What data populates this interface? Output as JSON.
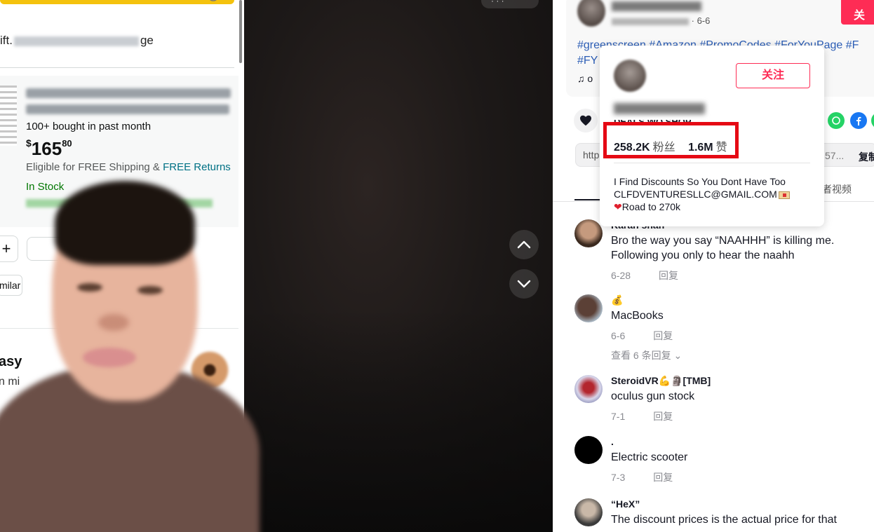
{
  "left": {
    "gift_prefix": "ift.",
    "gift_suffix": "ge",
    "product": {
      "bought": "100+ bought in past month",
      "price_currency": "$",
      "price_whole": "165",
      "price_fraction": "80",
      "shipping_prefix": "Eligible for FREE Shipping &",
      "shipping_link": "FREE Returns",
      "stock": "In Stock"
    },
    "plus_label": "+",
    "similar_label": "milar",
    "easy_label": "asy",
    "nmi_label": "n mi"
  },
  "nav": {
    "top_chip": "· · ·"
  },
  "post": {
    "author_date": "· 6-6",
    "follow_label": "关",
    "hashtags_line1": "#greenscreen #Amazon #PromoCodes #ForYouPage #F",
    "hashtags_line2": "#FY                                                    p...",
    "music_prefix": "o",
    "url_prefix": "http",
    "url_suffix": "57...",
    "copy_link": "复制",
    "creator_videos_tab": "者视频"
  },
  "popover": {
    "follow_label": "关注",
    "subname": "DEALS WO SHOP",
    "followers_value": "258.2K",
    "followers_label": "粉丝",
    "likes_value": "1.6M",
    "likes_label": "赞",
    "bio_line1": "I Find Discounts So You Dont Have Too",
    "bio_line2": "CLFDVENTURESLLC@GMAIL.COM",
    "bio_line3": "Road to 270k"
  },
  "comments": [
    {
      "name": "Karan shah",
      "text": "Bro the way you say “NAAHHH” is killing me. Following you only to hear the naahh",
      "date": "6-28",
      "reply": "回复"
    },
    {
      "name": "💰",
      "text": "MacBooks",
      "date": "6-6",
      "reply": "回复",
      "view_replies": "查看 6 条回复 ⌄"
    },
    {
      "name": "SteroidVR💪🗿[TMB]",
      "text": "oculus gun stock",
      "date": "7-1",
      "reply": "回复"
    },
    {
      "name": ".",
      "text": "Electric scooter",
      "date": "7-3",
      "reply": "回复"
    },
    {
      "name": "“HeX”",
      "text": "The discount prices is the actual price for that",
      "date": "",
      "reply": ""
    }
  ],
  "colors": {
    "brand_red": "#fe2c55",
    "link_blue": "#2b5db5",
    "amazon_link": "#007185",
    "stock_green": "#007600",
    "highlight_red": "#e50914"
  }
}
